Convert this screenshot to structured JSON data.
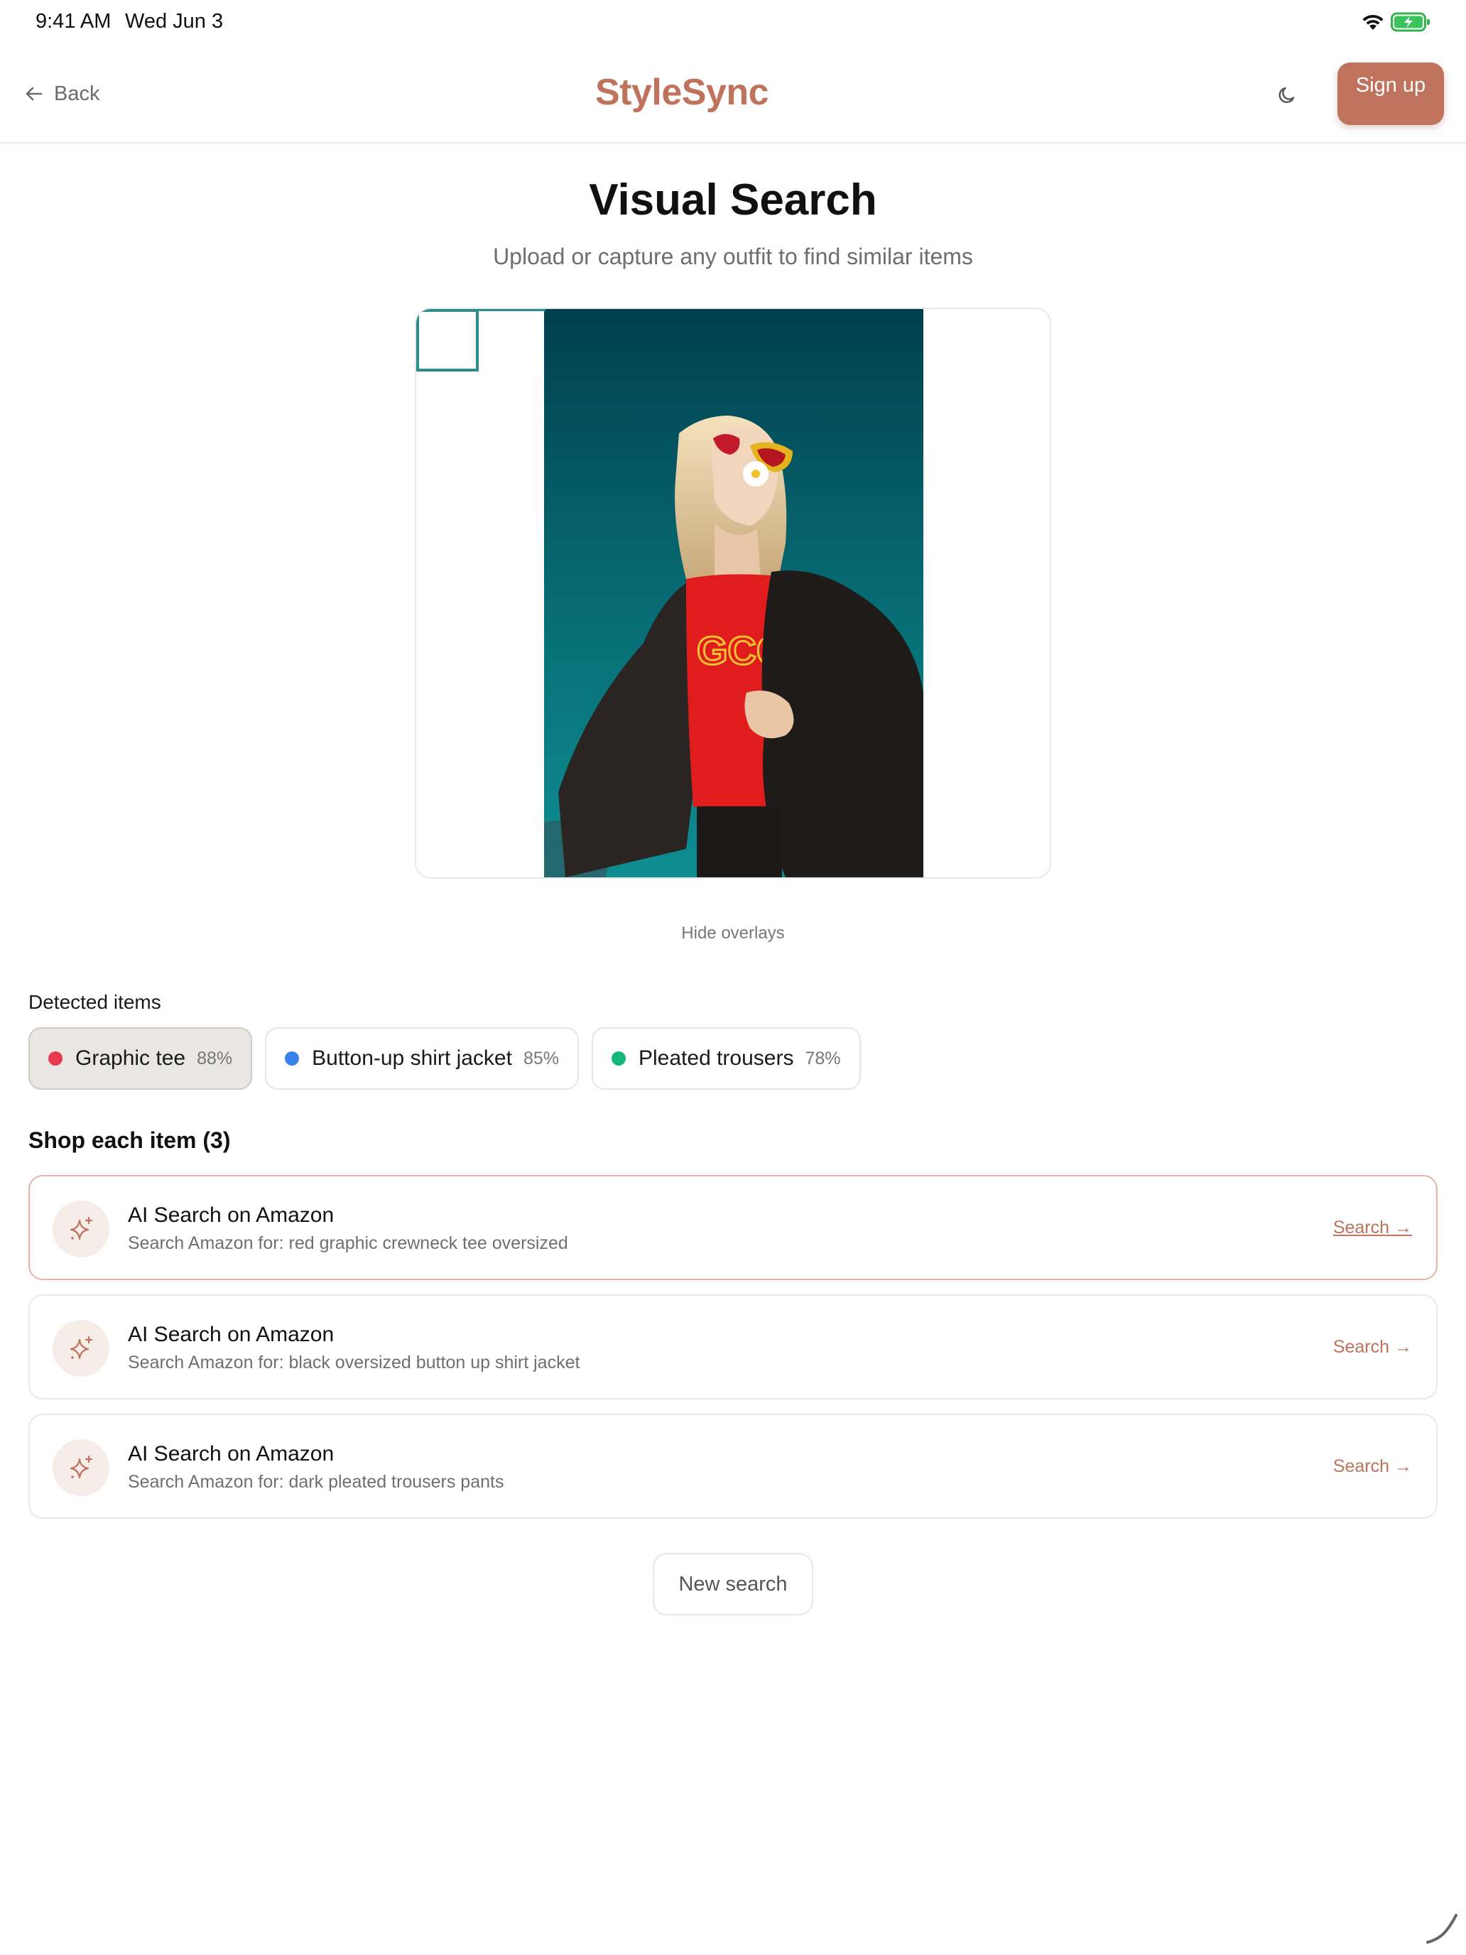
{
  "status_bar": {
    "time": "9:41 AM",
    "date": "Wed Jun 3"
  },
  "header": {
    "back_label": "Back",
    "app_title": "StyleSync",
    "signup_label": "Sign up",
    "accent_color": "#c0735c"
  },
  "page": {
    "title": "Visual Search",
    "subtitle": "Upload or capture any outfit to find similar items",
    "hide_overlays_label": "Hide overlays"
  },
  "detected": {
    "label": "Detected items",
    "items": [
      {
        "label": "Graphic tee",
        "confidence": "88%",
        "color": "#e8394f",
        "selected": true
      },
      {
        "label": "Button-up shirt jacket",
        "confidence": "85%",
        "color": "#3a82ee",
        "selected": false
      },
      {
        "label": "Pleated trousers",
        "confidence": "78%",
        "color": "#14b87a",
        "selected": false
      }
    ]
  },
  "shop": {
    "heading": "Shop each item (3)",
    "results": [
      {
        "title": "AI Search on Amazon",
        "query": "Search Amazon for: red graphic crewneck tee oversized",
        "action": "Search →",
        "icon": "sparkle-icon"
      },
      {
        "title": "AI Search on Amazon",
        "query": "Search Amazon for: black oversized button up shirt jacket",
        "action": "Search →",
        "icon": "sparkle-icon"
      },
      {
        "title": "AI Search on Amazon",
        "query": "Search Amazon for: dark pleated trousers pants",
        "action": "Search →",
        "icon": "sparkle-icon"
      }
    ]
  },
  "new_search_label": "New search"
}
